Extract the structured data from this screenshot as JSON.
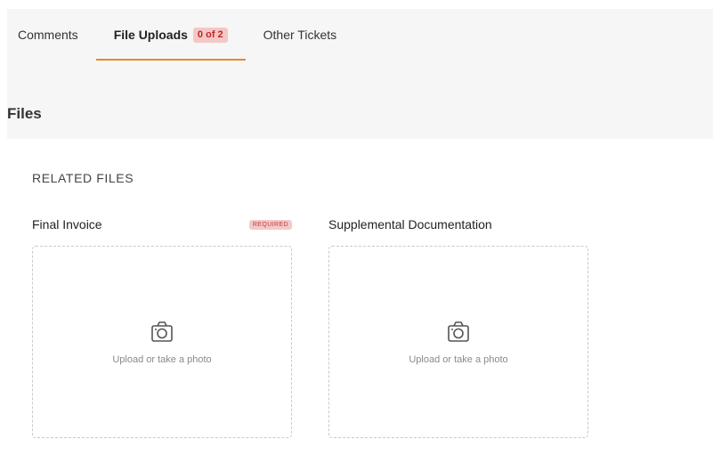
{
  "tabs": [
    {
      "label": "Comments"
    },
    {
      "label": "File Uploads",
      "badge": "0 of 2"
    },
    {
      "label": "Other Tickets"
    }
  ],
  "section": {
    "title": "Files"
  },
  "related": {
    "title": "RELATED FILES"
  },
  "uploads": [
    {
      "label": "Final Invoice",
      "required": "REQUIRED",
      "prompt": "Upload or take a photo",
      "icon": "camera-icon"
    },
    {
      "label": "Supplemental Documentation",
      "prompt": "Upload or take a photo",
      "icon": "camera-icon"
    }
  ],
  "colors": {
    "accent": "#e38b2a",
    "badge_bg": "#f4c7c7",
    "badge_text": "#c22525"
  }
}
